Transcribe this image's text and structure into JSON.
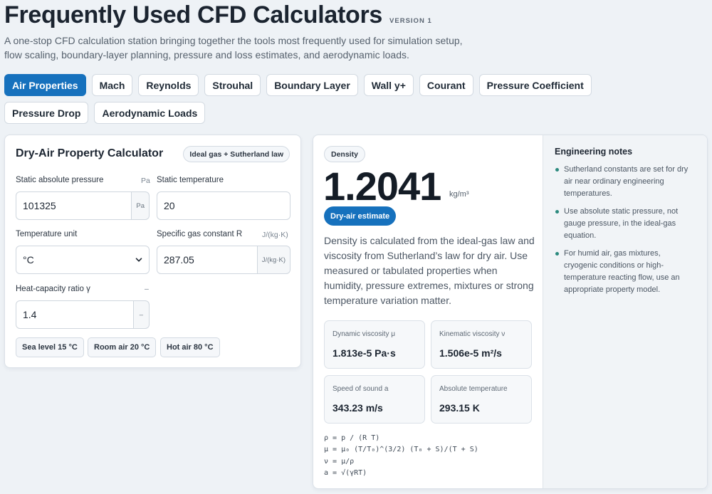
{
  "header": {
    "title": "Frequently Used CFD Calculators",
    "version": "VERSION 1",
    "subtitle": "A one-stop CFD calculation station bringing together the tools most frequently used for simulation setup, flow scaling, boundary-layer planning, pressure and loss estimates, and aerodynamic loads."
  },
  "tabs": [
    {
      "label": "Air Properties",
      "active": true
    },
    {
      "label": "Mach",
      "active": false
    },
    {
      "label": "Reynolds",
      "active": false
    },
    {
      "label": "Strouhal",
      "active": false
    },
    {
      "label": "Boundary Layer",
      "active": false
    },
    {
      "label": "Wall y+",
      "active": false
    },
    {
      "label": "Courant",
      "active": false
    },
    {
      "label": "Pressure Coefficient",
      "active": false
    },
    {
      "label": "Pressure Drop",
      "active": false
    },
    {
      "label": "Aerodynamic Loads",
      "active": false
    }
  ],
  "calculator": {
    "title": "Dry-Air Property Calculator",
    "method_badge": "Ideal gas + Sutherland law",
    "fields": {
      "pressure": {
        "label": "Static absolute pressure",
        "unit": "Pa",
        "value": "101325",
        "addon": "Pa"
      },
      "temperature": {
        "label": "Static temperature",
        "value": "20"
      },
      "temp_unit": {
        "label": "Temperature unit",
        "value": "°C"
      },
      "gas_constant": {
        "label": "Specific gas constant R",
        "unit": "J/(kg·K)",
        "value": "287.05",
        "addon": "J/(kg·K)"
      },
      "gamma": {
        "label": "Heat-capacity ratio γ",
        "unit": "–",
        "value": "1.4",
        "addon": "–"
      }
    },
    "presets": [
      "Sea level 15 °C",
      "Room air 20 °C",
      "Hot air 80 °C"
    ]
  },
  "result": {
    "badge": "Density",
    "value": "1.2041",
    "unit": "kg/m³",
    "estimate_badge": "Dry-air estimate",
    "description": "Density is calculated from the ideal-gas law and viscosity from Sutherland’s law for dry air. Use measured or tabulated properties when humidity, pressure extremes, mixtures or strong temperature variation matter.",
    "metrics": [
      {
        "label": "Dynamic viscosity μ",
        "value": "1.813e-5 Pa·s"
      },
      {
        "label": "Kinematic viscosity ν",
        "value": "1.506e-5 m²/s"
      },
      {
        "label": "Speed of sound a",
        "value": "343.23 m/s"
      },
      {
        "label": "Absolute temperature",
        "value": "293.15 K"
      }
    ],
    "formulas": [
      "ρ = p / (R T)",
      "μ = μ₀ (T/T₀)^(3/2) (T₀ + S)/(T + S)",
      "ν = μ/ρ",
      "a = √(γRT)"
    ]
  },
  "notes": {
    "title": "Engineering notes",
    "items": [
      "Sutherland constants are set for dry air near ordinary engineering temperatures.",
      "Use absolute static pressure, not gauge pressure, in the ideal-gas equation.",
      "For humid air, gas mixtures, cryogenic conditions or high-temperature reacting flow, use an appropriate property model."
    ]
  },
  "colors": {
    "accent": "#1671bd",
    "bullet": "#2b8a7e",
    "background": "#eef2f6"
  }
}
